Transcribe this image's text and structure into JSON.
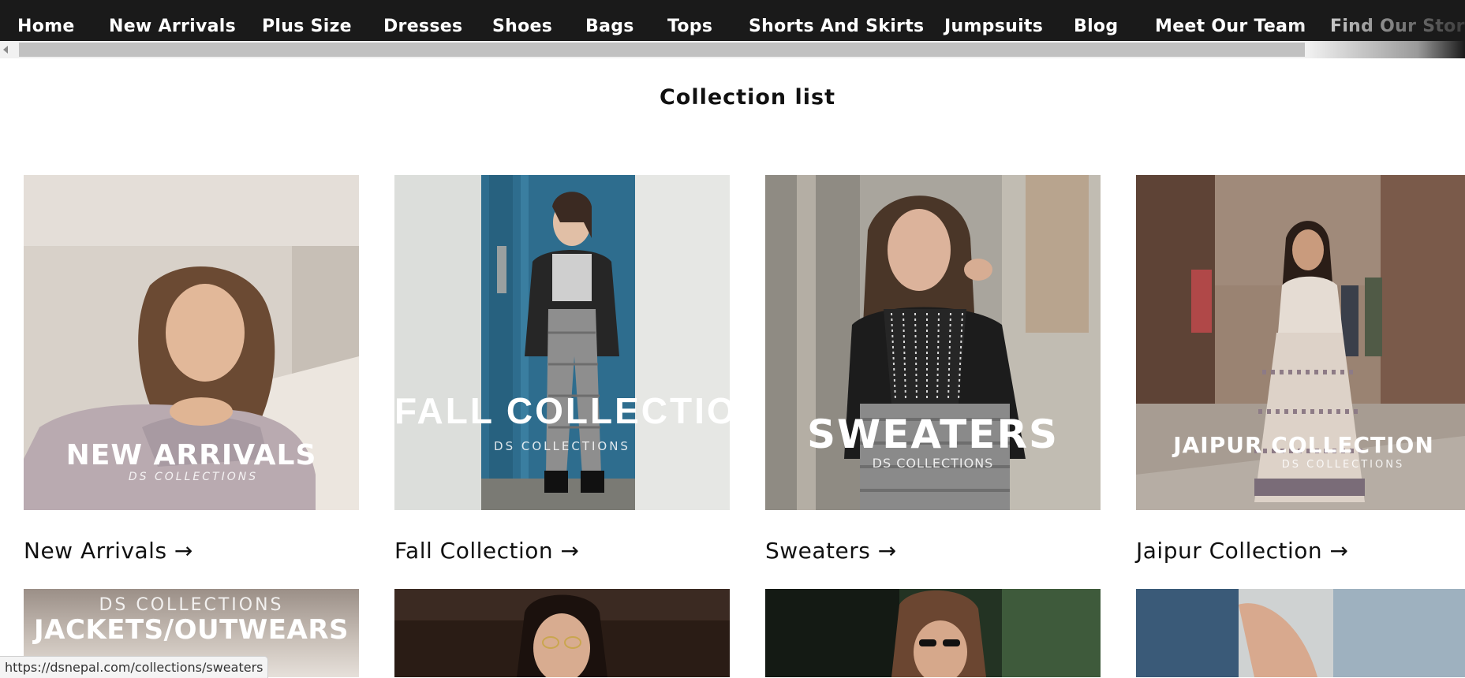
{
  "nav": {
    "items": [
      "Home",
      "New Arrivals",
      "Plus Size",
      "Dresses",
      "Shoes",
      "Bags",
      "Tops",
      "Shorts And Skirts",
      "Jumpsuits",
      "Blog",
      "Meet Our Team",
      "Find Our Stores"
    ]
  },
  "page": {
    "title": "Collection list"
  },
  "collections": [
    {
      "label": "New Arrivals →",
      "overlay_title": "NEW ARRIVALS",
      "overlay_sub": "DS COLLECTIONS"
    },
    {
      "label": "Fall Collection →",
      "overlay_title": "FALL COLLECTION",
      "overlay_sub": "DS  COLLECTIONS"
    },
    {
      "label": "Sweaters →",
      "overlay_title": "SWEATERS",
      "overlay_sub": "DS COLLECTIONS"
    },
    {
      "label": "Jaipur Collection →",
      "overlay_title": "JAIPUR COLLECTION",
      "overlay_sub": "DS COLLECTIONS"
    }
  ],
  "row2": [
    {
      "overlay_sub": "DS COLLECTIONS",
      "overlay_title": "JACKETS/OUTWEARS"
    }
  ],
  "status": {
    "url": "https://dsnepal.com/collections/sweaters"
  },
  "colors": {
    "nav_bg": "#1a1a1a",
    "nav_text": "#ffffff",
    "page_bg": "#ffffff",
    "text": "#111111"
  }
}
